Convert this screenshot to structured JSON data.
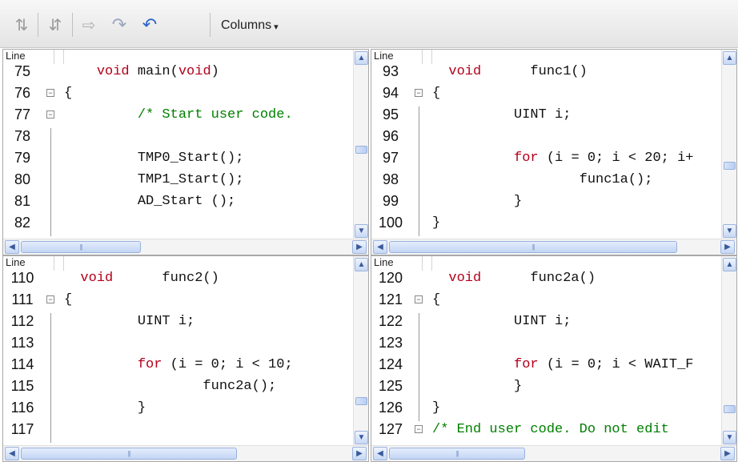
{
  "toolbar": {
    "buttons": [
      {
        "name": "sync-scroll-icon",
        "glyph": "⇅"
      },
      {
        "name": "unsync-scroll-icon",
        "glyph": "⇵"
      },
      {
        "name": "arrow-right-icon",
        "glyph": "⇨"
      },
      {
        "name": "redo-icon",
        "glyph": "↷"
      },
      {
        "name": "undo-icon",
        "glyph": "↶"
      }
    ],
    "columns_label": "Columns",
    "columns_caret": "▾"
  },
  "column_header": "Line",
  "panes": [
    {
      "rows": [
        {
          "ln": "75",
          "parts": [
            [
              "",
              "    "
            ],
            [
              "kw",
              "void"
            ],
            [
              "",
              " main("
            ],
            [
              "kw",
              "void"
            ],
            [
              "",
              ")"
            ]
          ]
        },
        {
          "ln": "76",
          "fold": "−",
          "parts": [
            [
              "",
              "{"
            ]
          ]
        },
        {
          "ln": "77",
          "fold": "−",
          "parts": [
            [
              "",
              "         "
            ],
            [
              "cm",
              "/* Start user code."
            ]
          ]
        },
        {
          "ln": "78",
          "parts": []
        },
        {
          "ln": "79",
          "parts": [
            [
              "",
              "         TMP0_Start();"
            ]
          ]
        },
        {
          "ln": "80",
          "parts": [
            [
              "",
              "         TMP1_Start();"
            ]
          ]
        },
        {
          "ln": "81",
          "parts": [
            [
              "",
              "         AD_Start ();"
            ]
          ]
        },
        {
          "ln": "82",
          "parts": []
        }
      ]
    },
    {
      "rows": [
        {
          "ln": "93",
          "parts": [
            [
              "",
              "  "
            ],
            [
              "kw",
              "void"
            ],
            [
              "",
              "      func1()"
            ]
          ]
        },
        {
          "ln": "94",
          "fold": "−",
          "parts": [
            [
              "",
              "{"
            ]
          ]
        },
        {
          "ln": "95",
          "parts": [
            [
              "",
              "          UINT i;"
            ]
          ]
        },
        {
          "ln": "96",
          "parts": []
        },
        {
          "ln": "97",
          "parts": [
            [
              "",
              "          "
            ],
            [
              "kw",
              "for"
            ],
            [
              "",
              " (i = 0; i < 20; i+"
            ]
          ]
        },
        {
          "ln": "98",
          "parts": [
            [
              "",
              "                  func1a();"
            ]
          ]
        },
        {
          "ln": "99",
          "parts": [
            [
              "",
              "          }"
            ]
          ]
        },
        {
          "ln": "100",
          "parts": [
            [
              "",
              "}"
            ]
          ]
        }
      ]
    },
    {
      "rows": [
        {
          "ln": "110",
          "parts": [
            [
              "",
              "  "
            ],
            [
              "kw",
              "void"
            ],
            [
              "",
              "      func2()"
            ]
          ]
        },
        {
          "ln": "111",
          "fold": "−",
          "parts": [
            [
              "",
              "{"
            ]
          ]
        },
        {
          "ln": "112",
          "parts": [
            [
              "",
              "         UINT i;"
            ]
          ]
        },
        {
          "ln": "113",
          "parts": []
        },
        {
          "ln": "114",
          "parts": [
            [
              "",
              "         "
            ],
            [
              "kw",
              "for"
            ],
            [
              "",
              " (i = 0; i < 10;"
            ]
          ]
        },
        {
          "ln": "115",
          "parts": [
            [
              "",
              "                 func2a();"
            ]
          ]
        },
        {
          "ln": "116",
          "parts": [
            [
              "",
              "         }"
            ]
          ]
        },
        {
          "ln": "117",
          "parts": []
        }
      ]
    },
    {
      "rows": [
        {
          "ln": "120",
          "parts": [
            [
              "",
              "  "
            ],
            [
              "kw",
              "void"
            ],
            [
              "",
              "      func2a()"
            ]
          ]
        },
        {
          "ln": "121",
          "fold": "−",
          "parts": [
            [
              "",
              "{"
            ]
          ]
        },
        {
          "ln": "122",
          "parts": [
            [
              "",
              "          UINT i;"
            ]
          ]
        },
        {
          "ln": "123",
          "parts": []
        },
        {
          "ln": "124",
          "parts": [
            [
              "",
              "          "
            ],
            [
              "kw",
              "for"
            ],
            [
              "",
              " (i = 0; i < WAIT_F"
            ]
          ]
        },
        {
          "ln": "125",
          "parts": [
            [
              "",
              "          }"
            ]
          ]
        },
        {
          "ln": "126",
          "parts": [
            [
              "",
              "}"
            ]
          ]
        },
        {
          "ln": "127",
          "fold": "−",
          "parts": [
            [
              "cm",
              "/* End user code. Do not edit"
            ]
          ]
        }
      ]
    }
  ],
  "scroll": {
    "up_glyph": "▲",
    "down_glyph": "▼",
    "left_glyph": "◀",
    "right_glyph": "▶",
    "thumb_grip": "|||"
  }
}
